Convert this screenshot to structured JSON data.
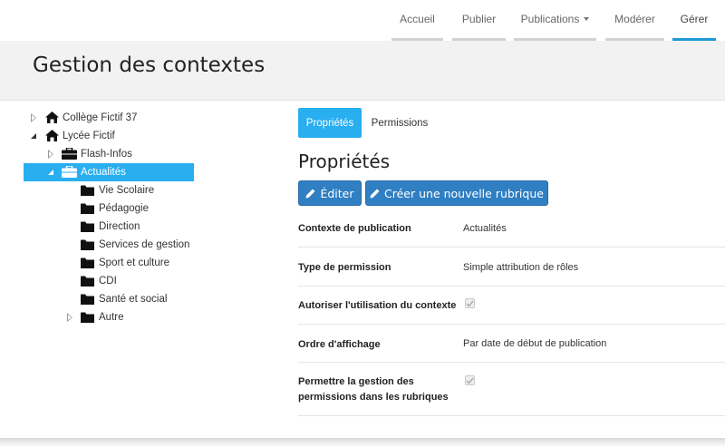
{
  "nav": {
    "items": [
      {
        "label": "Accueil",
        "active": false
      },
      {
        "label": "Publier",
        "active": false
      },
      {
        "label": "Publications",
        "active": false,
        "dropdown": true
      },
      {
        "label": "Modérer",
        "active": false
      },
      {
        "label": "Gérer",
        "active": true
      }
    ],
    "accent_color": "#1e9ad6"
  },
  "header": {
    "title": "Gestion des contextes"
  },
  "tree": {
    "nodes": [
      {
        "label": "Collège Fictif 37",
        "icon": "home-icon",
        "state": "collapsed"
      },
      {
        "label": "Lycée Fictif",
        "icon": "home-icon",
        "state": "expanded"
      },
      {
        "label": "Flash-Infos",
        "icon": "briefcase-icon",
        "state": "collapsed"
      },
      {
        "label": "Actualités",
        "icon": "briefcase-icon",
        "state": "expanded",
        "selected": true
      },
      {
        "label": "Vie Scolaire",
        "icon": "folder-icon"
      },
      {
        "label": "Pédagogie",
        "icon": "folder-icon"
      },
      {
        "label": "Direction",
        "icon": "folder-icon"
      },
      {
        "label": "Services de gestion",
        "icon": "folder-icon"
      },
      {
        "label": "Sport et culture",
        "icon": "folder-icon"
      },
      {
        "label": "CDI",
        "icon": "folder-icon"
      },
      {
        "label": "Santé et social",
        "icon": "folder-icon"
      },
      {
        "label": "Autre",
        "icon": "folder-icon",
        "state": "collapsed"
      }
    ],
    "selected_color": "#29aef0"
  },
  "tabs": [
    {
      "label": "Propriétés",
      "active": true
    },
    {
      "label": "Permissions",
      "active": false
    }
  ],
  "section_title": "Propriétés",
  "buttons": {
    "edit": "Éditer",
    "create_rubric": "Créer une nouvelle rubrique",
    "color": "#2f7fc2"
  },
  "properties": [
    {
      "label": "Contexte de publication",
      "value": "Actualités"
    },
    {
      "label": "Type de permission",
      "value": "Simple attribution de rôles"
    },
    {
      "label": "Autoriser l'utilisation du contexte",
      "checked": true
    },
    {
      "label": "Ordre d'affichage",
      "value": "Par date de début de publication"
    },
    {
      "label_line1": "Permettre la gestion des",
      "label_line2": "permissions dans les rubriques",
      "checked": true
    }
  ]
}
